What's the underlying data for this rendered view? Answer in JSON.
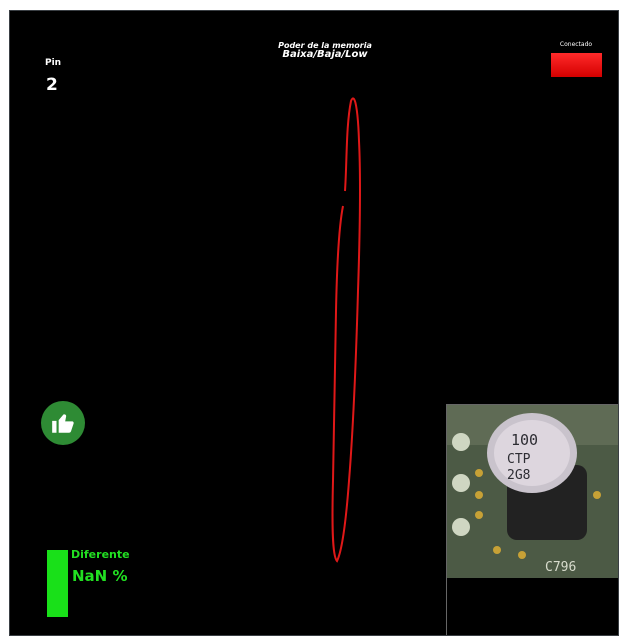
{
  "pin": {
    "label": "Pin",
    "value": "2"
  },
  "memory": {
    "title": "Poder de la memoria",
    "level": "Baixa/Baja/Low"
  },
  "connection": {
    "label": "Conectado",
    "indicator_color": "#e81010"
  },
  "difference": {
    "label": "Diferente",
    "value": "NaN %",
    "bar_color": "#19e019"
  },
  "thumbs_button": {
    "icon": "thumbs-up-icon",
    "color": "#2e8b34"
  },
  "trace": {
    "color": "#e01818"
  },
  "component_image": {
    "marking_line1": "100",
    "marking_line2": "CTP",
    "marking_line3": "2G8",
    "board_label": "C796"
  }
}
